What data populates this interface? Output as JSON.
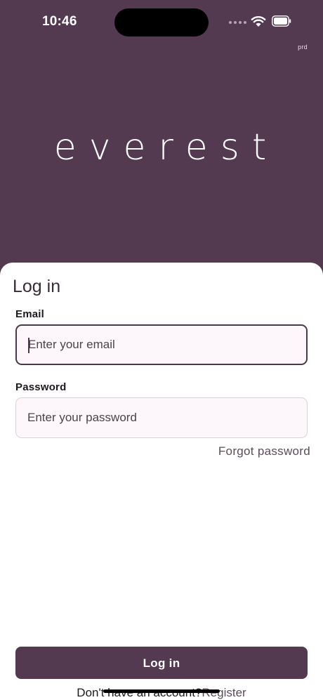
{
  "status_bar": {
    "time": "10:46"
  },
  "env_label": "prd",
  "brand": {
    "logo_text": "everest",
    "color": "#533a50"
  },
  "login_form": {
    "title": "Log in",
    "email": {
      "label": "Email",
      "value": "",
      "placeholder": "Enter your email"
    },
    "password": {
      "label": "Password",
      "value": "",
      "placeholder": "Enter your password"
    },
    "forgot_password": "Forgot password",
    "submit_label": "Log in",
    "register_prompt": "Don't have an account?",
    "register_link": "Register"
  },
  "icons": {
    "wifi": "wifi-icon",
    "battery": "battery-icon",
    "signal": "signal-dots-icon"
  }
}
